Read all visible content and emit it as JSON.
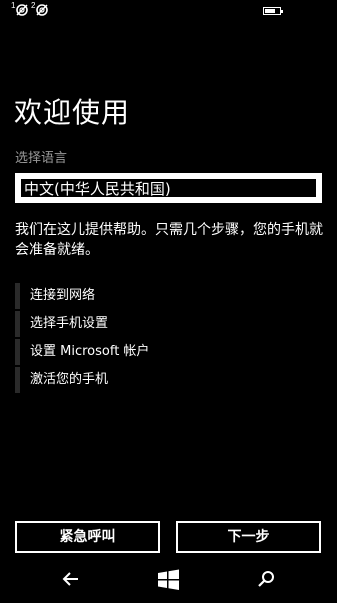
{
  "status_bar": {
    "sim1_label": "1",
    "sim2_label": "2",
    "signal_icon_1": "no-signal-icon",
    "signal_icon_2": "no-signal-icon",
    "battery_icon": "battery-icon",
    "battery_level": 0.7
  },
  "page": {
    "title": "欢迎使用",
    "language_label": "选择语言",
    "language_value": "中文(中华人民共和国)",
    "description": "我们在这儿提供帮助。只需几个步骤，您的手机就会准备就绪。"
  },
  "steps": [
    {
      "label": "连接到网络"
    },
    {
      "label": "选择手机设置"
    },
    {
      "label": "设置 Microsoft 帐户"
    },
    {
      "label": "激活您的手机"
    }
  ],
  "buttons": {
    "emergency_label": "紧急呼叫",
    "next_label": "下一步"
  },
  "nav": {
    "back_icon": "back-arrow-icon",
    "home_icon": "windows-icon",
    "search_icon": "search-icon"
  },
  "colors": {
    "background": "#000000",
    "foreground": "#ffffff",
    "secondary_text": "#9a9a9a",
    "step_bar": "#2a2a2a"
  }
}
